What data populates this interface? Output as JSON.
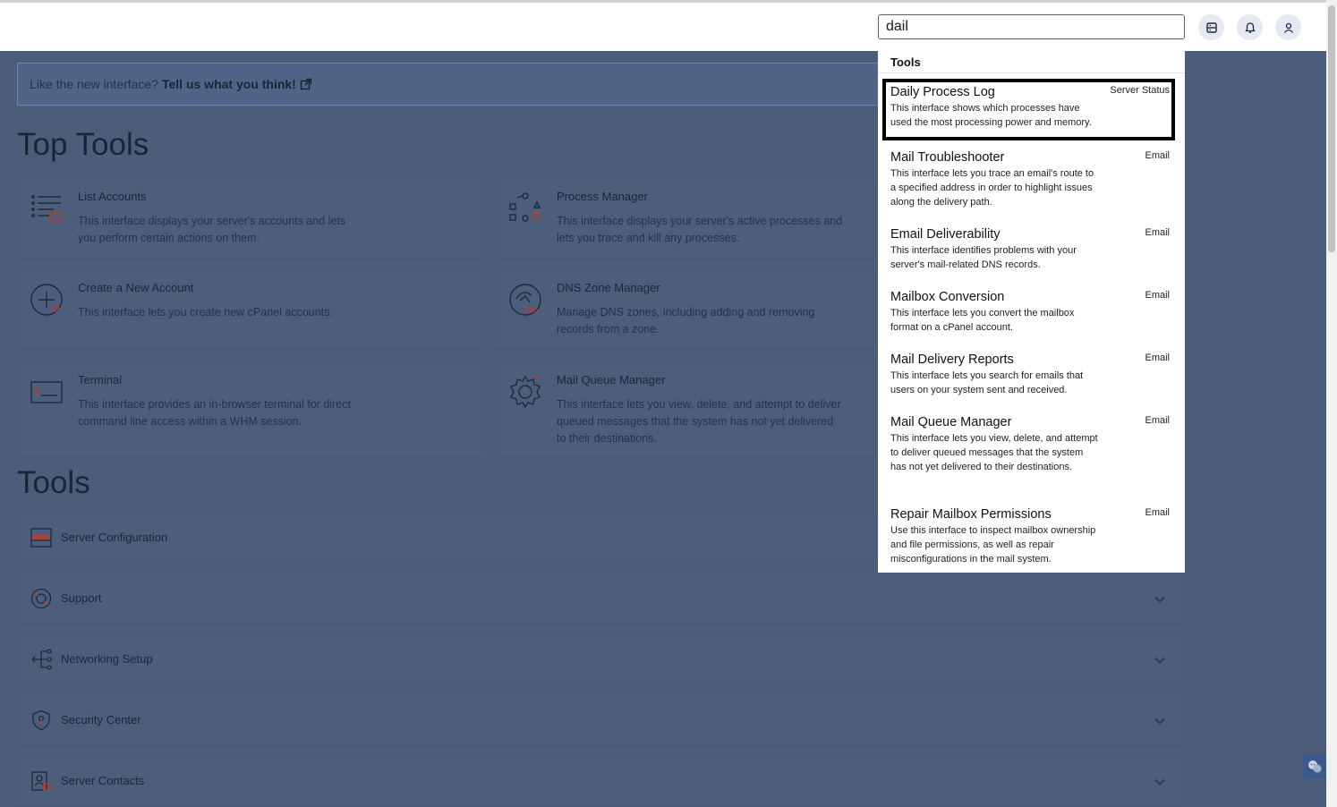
{
  "header": {
    "search_value": "dail",
    "buttons": [
      {
        "icon": "server-icon"
      },
      {
        "icon": "bell-icon"
      },
      {
        "icon": "user-icon"
      }
    ]
  },
  "feedback": {
    "text": "Like the new interface?",
    "link": "Tell us what you think!",
    "icon": "external-link-icon"
  },
  "top_tools": {
    "heading": "Top Tools",
    "cards": [
      {
        "title": "List Accounts",
        "desc": "This interface displays your server's accounts and lets you perform certain actions on them.",
        "icon": "list-accounts-icon"
      },
      {
        "title": "Process Manager",
        "desc": "This interface displays your server's active processes and lets you trace and kill any processes.",
        "icon": "process-manager-icon"
      },
      {
        "title": "Create a New Account",
        "desc": "This interface lets you create new cPanel accounts.",
        "icon": "create-account-icon"
      },
      {
        "title": "DNS Zone Manager",
        "desc": "Manage DNS zones, including adding and removing records from a zone.",
        "icon": "dns-zone-icon"
      },
      {
        "title": "Terminal",
        "desc": "This interface provides an in-browser terminal for direct command line access within a WHM session.",
        "icon": "terminal-icon"
      },
      {
        "title": "Mail Queue Manager",
        "desc": "This interface lets you view, delete, and attempt to deliver queued messages that the system has not yet delivered to their destinations.",
        "icon": "gear-icon"
      }
    ]
  },
  "tools": {
    "heading": "Tools",
    "sections": [
      {
        "label": "Server Configuration",
        "icon": "server-config-icon"
      },
      {
        "label": "Support",
        "icon": "support-icon"
      },
      {
        "label": "Networking Setup",
        "icon": "network-icon"
      },
      {
        "label": "Security Center",
        "icon": "security-icon"
      },
      {
        "label": "Server Contacts",
        "icon": "contacts-icon"
      }
    ]
  },
  "search_results": {
    "heading": "Tools",
    "items": [
      {
        "title": "Daily Process Log",
        "desc": "This interface shows which processes have used the most processing power and memory.",
        "category": "Server Status",
        "selected": true
      },
      {
        "title": "Mail Troubleshooter",
        "desc": "This interface lets you trace an email's route to a specified address in order to highlight issues along the delivery path.",
        "category": "Email"
      },
      {
        "title": "Email Deliverability",
        "desc": "This interface identifies problems with your server's mail-related DNS records.",
        "category": "Email"
      },
      {
        "title": "Mailbox Conversion",
        "desc": "This interface lets you convert the mailbox format on a cPanel account.",
        "category": "Email"
      },
      {
        "title": "Mail Delivery Reports",
        "desc": "This interface lets you search for emails that users on your system sent and received.",
        "category": "Email"
      },
      {
        "title": "Mail Queue Manager",
        "desc": "This interface lets you view, delete, and attempt to deliver queued messages that the system has not yet delivered to their destinations.",
        "category": "Email"
      },
      {
        "title": "Repair Mailbox Permissions",
        "desc": "Use this interface to inspect mailbox ownership and file permissions, as well as repair misconfigurations in the mail system.",
        "category": "Email"
      }
    ]
  },
  "chat_widget": {
    "icon": "chat-icon"
  },
  "colors": {
    "overlay": "#4c5d7a",
    "card": "#4d5e7b",
    "accent": "#c0392b"
  }
}
